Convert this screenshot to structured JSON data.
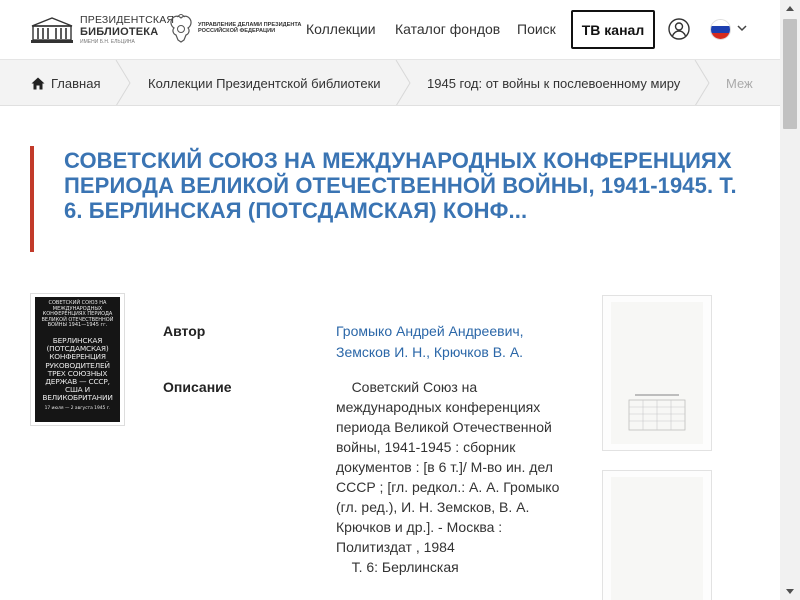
{
  "header": {
    "logo_pres": {
      "line1": "ПРЕЗИДЕНТСКАЯ",
      "line2": "БИБЛИОТЕКА",
      "line3": "ИМЕНИ Б.Н. ЕЛЬЦИНА"
    },
    "logo_udp": {
      "line1": "УПРАВЛЕНИЕ ДЕЛАМИ ПРЕЗИДЕНТА",
      "line2": "РОССИЙСКОЙ ФЕДЕРАЦИИ"
    },
    "nav": {
      "collections": "Коллекции",
      "catalog": "Каталог фондов",
      "search": "Поиск",
      "tv": "ТВ канал"
    },
    "colors": {
      "flag_white": "#ffffff",
      "flag_blue": "#1c3fb0",
      "flag_red": "#d52b1e"
    }
  },
  "breadcrumbs": [
    {
      "label": "Главная",
      "icon": "home-icon"
    },
    {
      "label": "Коллекции Президентской библиотеки"
    },
    {
      "label": "1945 год: от войны к послевоенному миру"
    },
    {
      "label": "Меж"
    }
  ],
  "record": {
    "title": "Советский Союз на международных конференциях периода Великой Отечественной войны, 1941-1945. Т. 6. Берлинская (Потсдамская) конф...",
    "cover": {
      "top": "СОВЕТСКИЙ СОЮЗ НА МЕЖДУНАРОДНЫХ КОНФЕРЕНЦИЯХ ПЕРИОДА ВЕЛИКОЙ ОТЕЧЕСТВЕННОЙ ВОЙНЫ 1941—1945 гг.",
      "main": "БЕРЛИНСКАЯ (ПОТСДАМСКАЯ) КОНФЕРЕНЦИЯ РУКОВОДИТЕЛЕЙ ТРЕХ СОЮЗНЫХ ДЕРЖАВ — СССР, США И ВЕЛИКОБРИТАНИИ",
      "bottom": "17 июля — 2 августа 1945 г."
    },
    "author_label": "Автор",
    "authors": [
      "Громыко Андрей Андреевич,",
      "Земсков И. Н., Крючков В. А."
    ],
    "description_label": "Описание",
    "description": "    Советский Союз на международных конференциях периода Великой Отечественной войны, 1941-1945 : сборник документов : [в 6 т.]/ М-во ин. дел СССР ; [гл. редкол.: А. А. Громыко (гл. ред.), И. Н. Земсков, В. А. Крючков и др.]. - Москва : Политиздат , 1984\n    Т. 6: Берлинская"
  },
  "colors": {
    "accent_red": "#c23a2a",
    "title_blue": "#3a74b3",
    "link_blue": "#2b67a8"
  }
}
